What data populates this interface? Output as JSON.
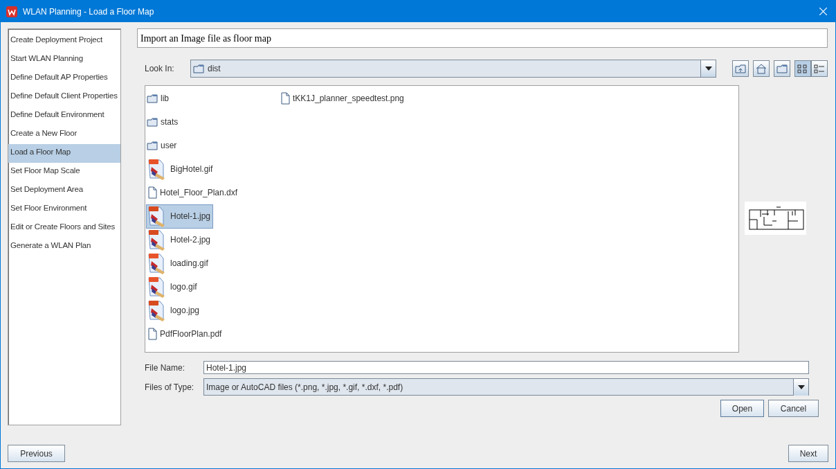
{
  "window": {
    "title": "WLAN Planning - Load a Floor Map"
  },
  "sidebar": {
    "items": [
      {
        "label": "Create Deployment Project",
        "selected": false
      },
      {
        "label": "Start WLAN Planning",
        "selected": false
      },
      {
        "label": "Define Default AP Properties",
        "selected": false
      },
      {
        "label": "Define Default Client Properties",
        "selected": false
      },
      {
        "label": "Define Default Environment",
        "selected": false
      },
      {
        "label": "Create a New Floor",
        "selected": false
      },
      {
        "label": "Load a Floor Map",
        "selected": true
      },
      {
        "label": "Set Floor Map Scale",
        "selected": false
      },
      {
        "label": "Set Deployment Area",
        "selected": false
      },
      {
        "label": "Set Floor Environment",
        "selected": false
      },
      {
        "label": "Edit or Create Floors and Sites",
        "selected": false
      },
      {
        "label": "Generate a WLAN Plan",
        "selected": false
      }
    ]
  },
  "heading": "Import an Image file as floor map",
  "look_in": {
    "label": "Look In:",
    "value": "dist"
  },
  "toolbar": [
    {
      "kind": "up",
      "selected": false
    },
    {
      "kind": "home",
      "selected": false
    },
    {
      "kind": "new-folder",
      "selected": false
    },
    {
      "kind": "list",
      "selected": true
    },
    {
      "kind": "details",
      "selected": false
    }
  ],
  "files": [
    {
      "name": "lib",
      "kind": "folder",
      "selected": false
    },
    {
      "name": "stats",
      "kind": "folder",
      "selected": false
    },
    {
      "name": "user",
      "kind": "folder",
      "selected": false
    },
    {
      "name": "BigHotel.gif",
      "kind": "gif",
      "selected": false
    },
    {
      "name": "Hotel_Floor_Plan.dxf",
      "kind": "file",
      "selected": false
    },
    {
      "name": "Hotel-1.jpg",
      "kind": "jpg",
      "selected": true
    },
    {
      "name": "Hotel-2.jpg",
      "kind": "jpg",
      "selected": false
    },
    {
      "name": "loading.gif",
      "kind": "gif",
      "selected": false
    },
    {
      "name": "logo.gif",
      "kind": "gif",
      "selected": false
    },
    {
      "name": "logo.jpg",
      "kind": "jpg",
      "selected": false
    },
    {
      "name": "PdfFloorPlan.pdf",
      "kind": "file",
      "selected": false
    },
    {
      "name": "tKK1J_planner_speedtest.png",
      "kind": "file",
      "selected": false
    }
  ],
  "file_name": {
    "label": "File Name:",
    "value": "Hotel-1.jpg"
  },
  "file_type": {
    "label": "Files of Type:",
    "value": "Image or AutoCAD files (*.png, *.jpg, *.gif, *.dxf, *.pdf)"
  },
  "dialog_buttons": [
    "Open",
    "Cancel"
  ],
  "nav_buttons": [
    "Previous",
    "Next"
  ]
}
